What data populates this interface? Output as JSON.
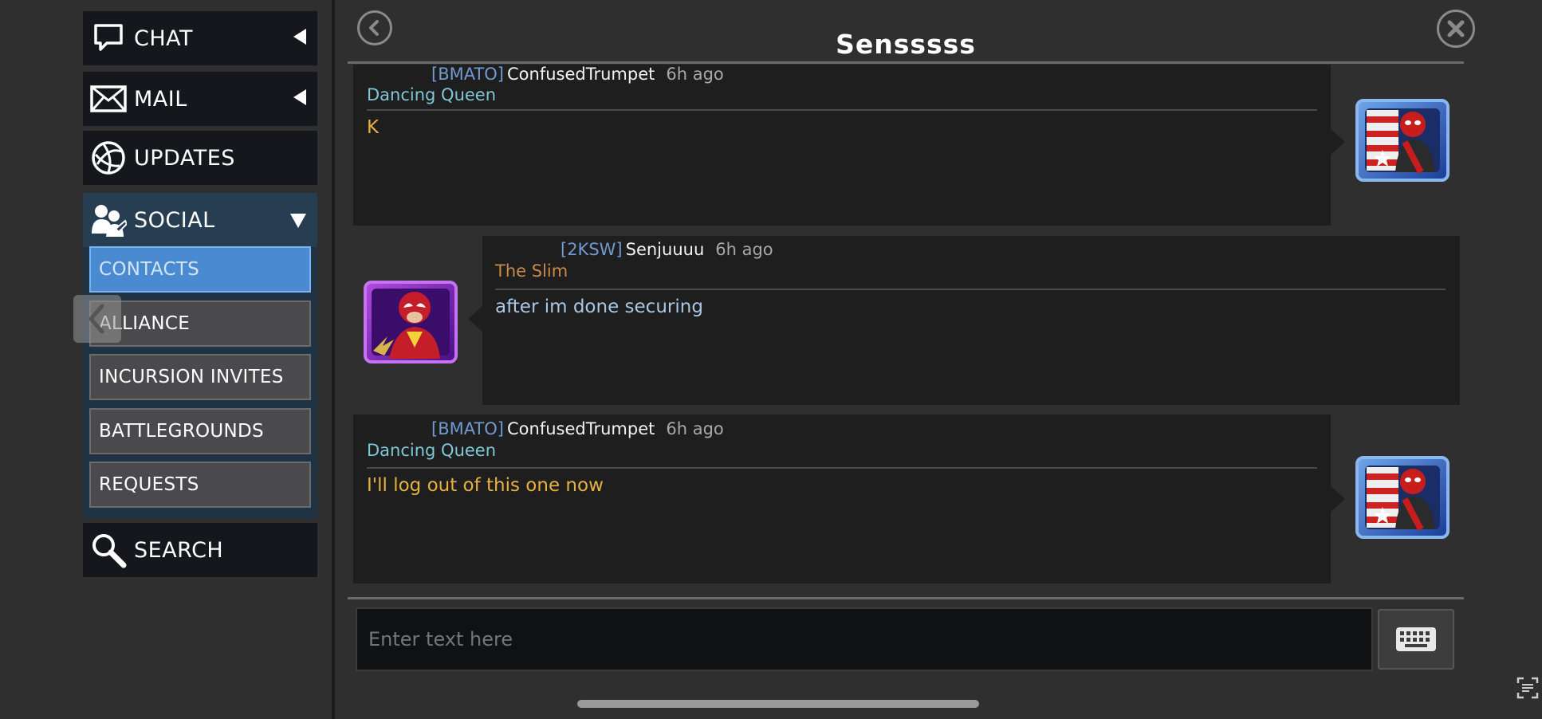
{
  "sidebar": {
    "chat_label": "CHAT",
    "mail_label": "MAIL",
    "updates_label": "UPDATES",
    "social_label": "SOCIAL",
    "search_label": "SEARCH",
    "social_items": [
      "CONTACTS",
      "ALLIANCE",
      "INCURSION INVITES",
      "BATTLEGROUNDS",
      "REQUESTS"
    ],
    "active_item": "CONTACTS"
  },
  "chat": {
    "title": "Sensssss",
    "messages": [
      {
        "tag": "[BMATO]",
        "name": "ConfusedTrumpet",
        "time": "6h ago",
        "subtitle": "Dancing Queen",
        "text": "K",
        "side": "right",
        "avatar": "deadpool-avatar"
      },
      {
        "tag": "[2KSW]",
        "name": "Senjuuuu",
        "time": "6h ago",
        "subtitle": "The Slim",
        "text": "after im done securing",
        "side": "left",
        "avatar": "spider-woman-avatar"
      },
      {
        "tag": "[BMATO]",
        "name": "ConfusedTrumpet",
        "time": "6h ago",
        "subtitle": "Dancing Queen",
        "text": "I'll log out of this one now",
        "side": "right",
        "avatar": "deadpool-avatar"
      }
    ],
    "input_placeholder": "Enter text here"
  },
  "colors": {
    "tag": "#6f9ad2",
    "subtitle_right": "#7ec8d8",
    "subtitle_left": "#c98a4a",
    "text_right": "#e8b040",
    "text_left": "#a9c6e2",
    "active_tab": "#4a8ad0"
  }
}
